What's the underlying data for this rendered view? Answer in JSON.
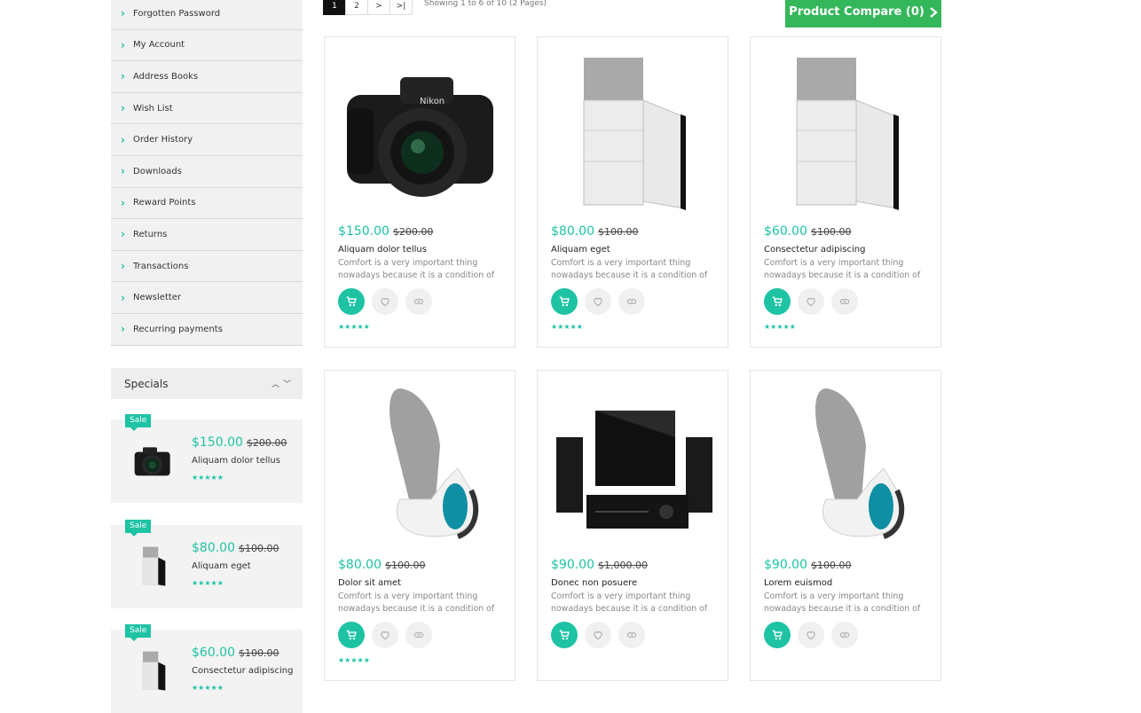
{
  "account_menu": [
    "Forgotten Password",
    "My Account",
    "Address Books",
    "Wish List",
    "Order History",
    "Downloads",
    "Reward Points",
    "Returns",
    "Transactions",
    "Newsletter",
    "Recurring payments"
  ],
  "specials": {
    "title": "Specials",
    "sale_label": "Sale",
    "items": [
      {
        "price": "$150.00",
        "old_price": "$200.00",
        "name": "Aliquam dolor tellus",
        "image": "camera"
      },
      {
        "price": "$80.00",
        "old_price": "$100.00",
        "name": "Aliquam eget",
        "image": "fridge"
      },
      {
        "price": "$60.00",
        "old_price": "$100.00",
        "name": "Consectetur adipiscing",
        "image": "fridge"
      }
    ]
  },
  "pagination": {
    "pages": [
      "1",
      "2",
      ">",
      ">|"
    ],
    "active": "1",
    "summary": "Showing 1 to 6 of 10 (2 Pages)"
  },
  "compare_button": {
    "label": "Product Compare (0)"
  },
  "rating_stars": "★★★★★",
  "products": [
    {
      "price": "$150.00",
      "old_price": "$200.00",
      "name": "Aliquam dolor tellus",
      "description": "Comfort is a very important thing nowadays because it is a condition of satisfaction and..",
      "image": "camera"
    },
    {
      "price": "$80.00",
      "old_price": "$100.00",
      "name": "Aliquam eget",
      "description": "Comfort is a very important thing nowadays because it is a condition of satisfaction and..",
      "image": "fridge"
    },
    {
      "price": "$60.00",
      "old_price": "$100.00",
      "name": "Consectetur adipiscing",
      "description": "Comfort is a very important thing nowadays because it is a condition of satisfaction and..",
      "image": "fridge"
    },
    {
      "price": "$80.00",
      "old_price": "$100.00",
      "name": "Dolor sit amet",
      "description": "Comfort is a very important thing nowadays because it is a condition of satisfaction and..",
      "image": "vacuum"
    },
    {
      "price": "$90.00",
      "old_price": "$1,000.00",
      "name": "Donec non posuere",
      "description": "Comfort is a very important thing nowadays because it is a condition of satisfaction and..",
      "image": "speakers"
    },
    {
      "price": "$90.00",
      "old_price": "$100.00",
      "name": "Lorem euismod",
      "description": "Comfort is a very important thing nowadays because it is a condition of satisfaction and..",
      "image": "vacuum"
    }
  ],
  "colors": {
    "accent": "#1ec3a4",
    "compare": "#34b75a"
  }
}
